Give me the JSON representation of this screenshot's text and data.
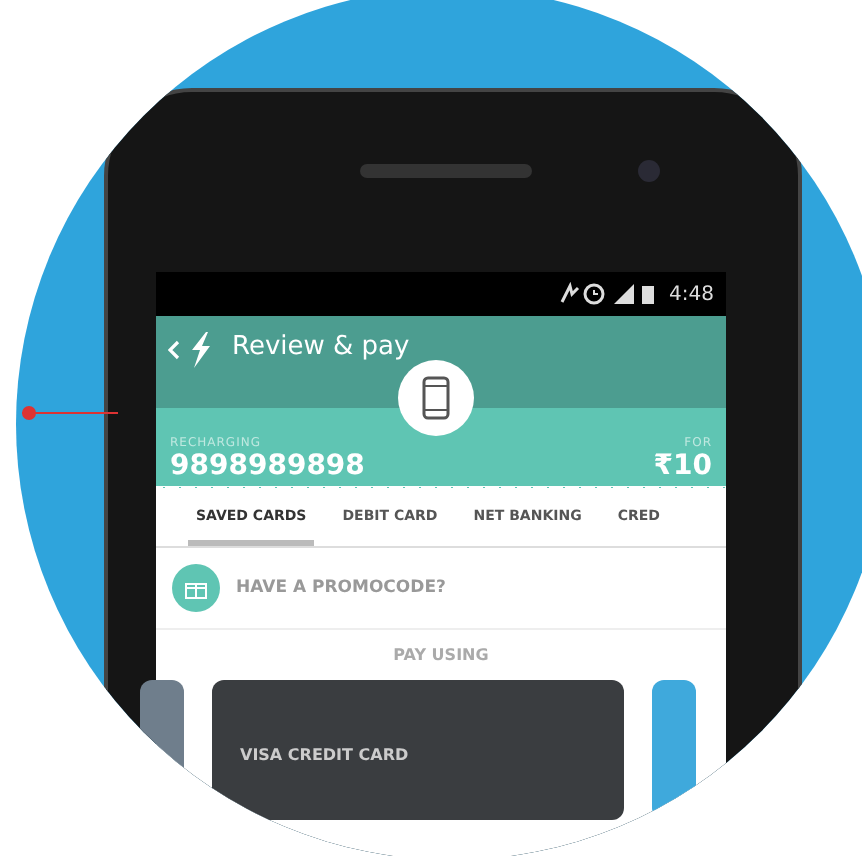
{
  "status_bar": {
    "time": "4:48"
  },
  "header": {
    "title": "Review & pay"
  },
  "recharge": {
    "label": "RECHARGING",
    "number": "9898989898",
    "amount_label": "FOR",
    "amount": "₹10"
  },
  "tabs": [
    {
      "label": "SAVED CARDS",
      "selected": true
    },
    {
      "label": "DEBIT CARD",
      "selected": false
    },
    {
      "label": "NET BANKING",
      "selected": false
    },
    {
      "label": "CRED",
      "selected": false
    }
  ],
  "promo": {
    "text": "HAVE A PROMOCODE?"
  },
  "pay_using": {
    "heading": "PAY USING",
    "cards": [
      {
        "kind": "side",
        "color": "#6f7e8c"
      },
      {
        "kind": "main",
        "label": "VISA CREDIT CARD",
        "color": "#3a3d40"
      },
      {
        "kind": "side",
        "color": "#3fa9dc"
      }
    ]
  }
}
